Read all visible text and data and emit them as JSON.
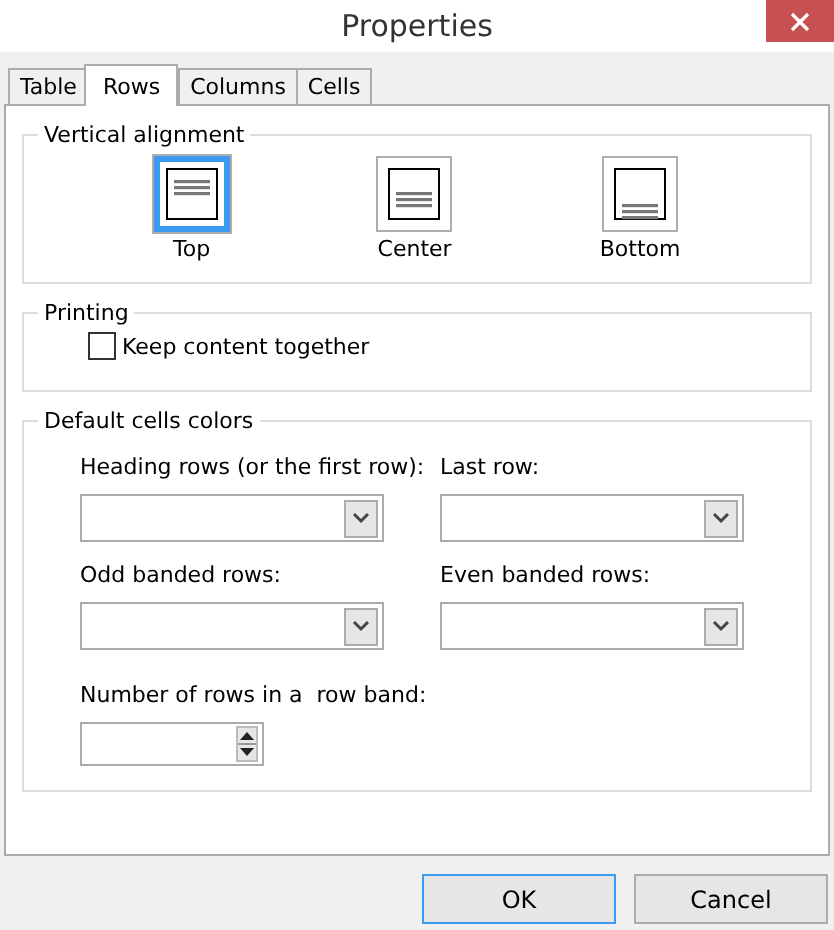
{
  "window": {
    "title": "Properties"
  },
  "tabs": [
    {
      "label": "Table",
      "selected": false
    },
    {
      "label": "Rows",
      "selected": true
    },
    {
      "label": "Columns",
      "selected": false
    },
    {
      "label": "Cells",
      "selected": false
    }
  ],
  "vertical_alignment": {
    "title": "Vertical alignment",
    "options": [
      {
        "label": "Top",
        "kind": "top",
        "selected": true
      },
      {
        "label": "Center",
        "kind": "center",
        "selected": false
      },
      {
        "label": "Bottom",
        "kind": "bottom",
        "selected": false
      }
    ]
  },
  "printing": {
    "title": "Printing",
    "checkbox": {
      "label": "Keep content together",
      "checked": false
    }
  },
  "default_cells_colors": {
    "title": "Default cells colors",
    "dropdowns": [
      {
        "label": "Heading rows (or the first row):"
      },
      {
        "label": "Last row:"
      },
      {
        "label": "Odd banded rows:"
      },
      {
        "label": "Even banded rows:"
      }
    ],
    "spinner": {
      "label": "Number of rows in a  row band:"
    }
  },
  "buttons": [
    {
      "label": "OK",
      "default": true
    },
    {
      "label": "Cancel",
      "default": false
    }
  ]
}
